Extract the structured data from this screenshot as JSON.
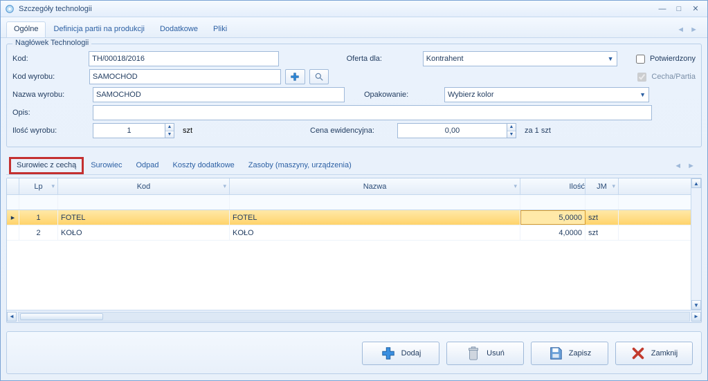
{
  "window": {
    "title": "Szczegóły technologii"
  },
  "tabs": {
    "items": [
      "Ogólne",
      "Definicja partii na produkcji",
      "Dodatkowe",
      "Pliki"
    ],
    "active_index": 0
  },
  "header": {
    "legend": "Nagłówek Technologii",
    "kod_label": "Kod:",
    "kod_value": "TH/00018/2016",
    "kod_wyrobu_label": "Kod wyrobu:",
    "kod_wyrobu_value": "SAMOCHÓD",
    "nazwa_wyrobu_label": "Nazwa wyrobu:",
    "nazwa_wyrobu_value": "SAMOCHÓD",
    "opis_label": "Opis:",
    "opis_value": "",
    "ilosc_wyrobu_label": "Ilość wyrobu:",
    "ilosc_wyrobu_value": "1",
    "ilosc_jm": "szt",
    "oferta_dla_label": "Oferta dla:",
    "oferta_dla_value": "Kontrahent",
    "opakowanie_label": "Opakowanie:",
    "opakowanie_value": "Wybierz kolor",
    "cena_label": "Cena ewidencyjna:",
    "cena_value": "0,00",
    "cena_jm": "za 1 szt",
    "checkbox_potwierdzony": "Potwierdzony",
    "checkbox_cecha_partia": "Cecha/Partia"
  },
  "inner_tabs": {
    "items": [
      "Surowiec z cechą",
      "Surowiec",
      "Odpad",
      "Koszty dodatkowe",
      "Zasoby (maszyny, urządzenia)"
    ],
    "highlighted_index": 0
  },
  "grid": {
    "columns": {
      "lp": "Lp",
      "kod": "Kod",
      "nazwa": "Nazwa",
      "ilosc": "Ilość",
      "jm": "JM"
    },
    "rows": [
      {
        "lp": "1",
        "kod": "FOTEL",
        "nazwa": "FOTEL",
        "ilosc": "5,0000",
        "jm": "szt",
        "selected": true
      },
      {
        "lp": "2",
        "kod": "KOŁO",
        "nazwa": "KOŁO",
        "ilosc": "4,0000",
        "jm": "szt",
        "selected": false
      }
    ]
  },
  "footer": {
    "dodaj": "Dodaj",
    "usun": "Usuń",
    "zapisz": "Zapisz",
    "zamknij": "Zamknij"
  }
}
